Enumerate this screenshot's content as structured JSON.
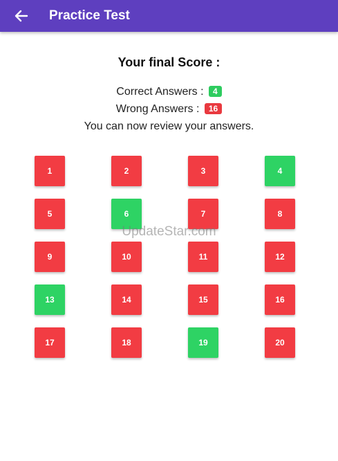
{
  "appbar": {
    "title": "Practice Test"
  },
  "score": {
    "heading": "Your final Score :",
    "correct_label": "Correct Answers :",
    "correct_count": "4",
    "wrong_label": "Wrong Answers :",
    "wrong_count": "16",
    "review_text": "You can now review your answers."
  },
  "questions": [
    {
      "label": "1",
      "status": "wrong"
    },
    {
      "label": "2",
      "status": "wrong"
    },
    {
      "label": "3",
      "status": "wrong"
    },
    {
      "label": "4",
      "status": "correct"
    },
    {
      "label": "5",
      "status": "wrong"
    },
    {
      "label": "6",
      "status": "correct"
    },
    {
      "label": "7",
      "status": "wrong"
    },
    {
      "label": "8",
      "status": "wrong"
    },
    {
      "label": "9",
      "status": "wrong"
    },
    {
      "label": "10",
      "status": "wrong"
    },
    {
      "label": "11",
      "status": "wrong"
    },
    {
      "label": "12",
      "status": "wrong"
    },
    {
      "label": "13",
      "status": "correct"
    },
    {
      "label": "14",
      "status": "wrong"
    },
    {
      "label": "15",
      "status": "wrong"
    },
    {
      "label": "16",
      "status": "wrong"
    },
    {
      "label": "17",
      "status": "wrong"
    },
    {
      "label": "18",
      "status": "wrong"
    },
    {
      "label": "19",
      "status": "correct"
    },
    {
      "label": "20",
      "status": "wrong"
    }
  ],
  "watermark": "UpdateStar.com",
  "colors": {
    "appbar": "#5e3fbf",
    "correct": "#2ed364",
    "wrong": "#f23c43"
  }
}
